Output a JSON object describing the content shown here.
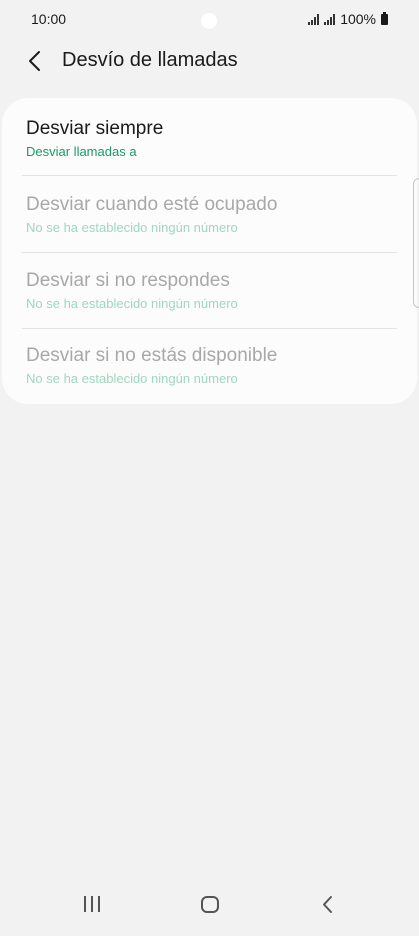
{
  "status_bar": {
    "time": "10:00",
    "battery_text": "100%",
    "icons": [
      "signal-icon",
      "signal-icon",
      "battery-icon"
    ]
  },
  "app_bar": {
    "back_icon": "chevron-left-icon",
    "title": "Desvío de llamadas"
  },
  "forwarding_options": [
    {
      "title": "Desviar siempre",
      "subtitle": "Desviar llamadas a",
      "enabled": true
    },
    {
      "title": "Desviar cuando esté ocupado",
      "subtitle": "No se ha establecido ningún número",
      "enabled": false
    },
    {
      "title": "Desviar si no respondes",
      "subtitle": "No se ha establecido ningún número",
      "enabled": false
    },
    {
      "title": "Desviar si no estás disponible",
      "subtitle": "No se ha establecido ningún número",
      "enabled": false
    }
  ],
  "colors": {
    "background": "#f2f2f2",
    "card": "#fcfcfc",
    "accent": "#1a9a68",
    "disabled_text": "#a8a8a8",
    "disabled_subtitle": "#9fd6c0"
  },
  "nav_bar": {
    "buttons": [
      "recent-apps-icon",
      "home-icon",
      "back-icon"
    ]
  }
}
